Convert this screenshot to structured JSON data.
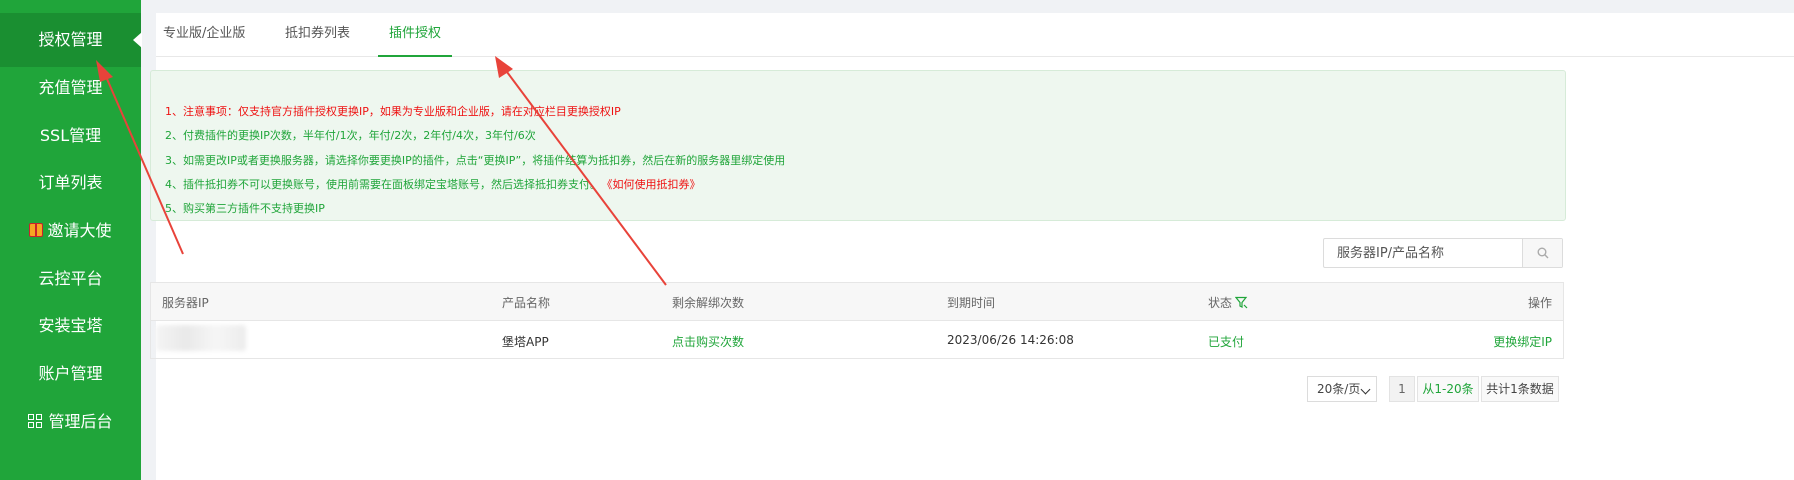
{
  "sidebar": {
    "items": [
      {
        "label": "授权管理"
      },
      {
        "label": "充值管理"
      },
      {
        "label": "SSL管理"
      },
      {
        "label": "订单列表"
      },
      {
        "label": "邀请大使"
      },
      {
        "label": "云控平台"
      },
      {
        "label": "安装宝塔"
      },
      {
        "label": "账户管理"
      },
      {
        "label": "管理后台"
      }
    ],
    "active_index": 0
  },
  "tabs": [
    {
      "label": "专业版/企业版"
    },
    {
      "label": "抵扣券列表"
    },
    {
      "label": "插件授权"
    }
  ],
  "notice": {
    "lines": [
      "1、注意事项：仅支持官方插件授权更换IP，如果为专业版和企业版，请在对应栏目更换授权IP",
      "2、付费插件的更换IP次数，半年付/1次，年付/2次，2年付/4次，3年付/6次",
      "3、如需更改IP或者更换服务器，请选择你要更换IP的插件，点击“更换IP”，将插件结算为抵扣券，然后在新的服务器里绑定使用",
      "4、插件抵扣券不可以更换账号，使用前需要在面板绑定宝塔账号，然后选择抵扣券支付。",
      "5、购买第三方插件不支持更换IP"
    ],
    "link": "《如何使用抵扣券》"
  },
  "search": {
    "placeholder": "服务器IP/产品名称"
  },
  "table": {
    "headers": [
      "服务器IP",
      "产品名称",
      "剩余解绑次数",
      "到期时间",
      "状态",
      "操作"
    ],
    "rows": [
      {
        "product": "堡塔APP",
        "unbind": "点击购买次数",
        "expire": "2023/06/26 14:26:08",
        "status": "已支付",
        "action": "更换绑定IP"
      }
    ]
  },
  "pagination": {
    "page_size": "20条/页",
    "current_page": "1",
    "range": "从1-20条",
    "total": "共计1条数据"
  },
  "colors": {
    "accent": "#20a53a",
    "warning": "#ee1111",
    "annotation_arrow": "#e8433a"
  },
  "icons": [
    "gift-icon",
    "grid-icon",
    "search-icon",
    "filter-icon",
    "chevron-down-icon"
  ]
}
